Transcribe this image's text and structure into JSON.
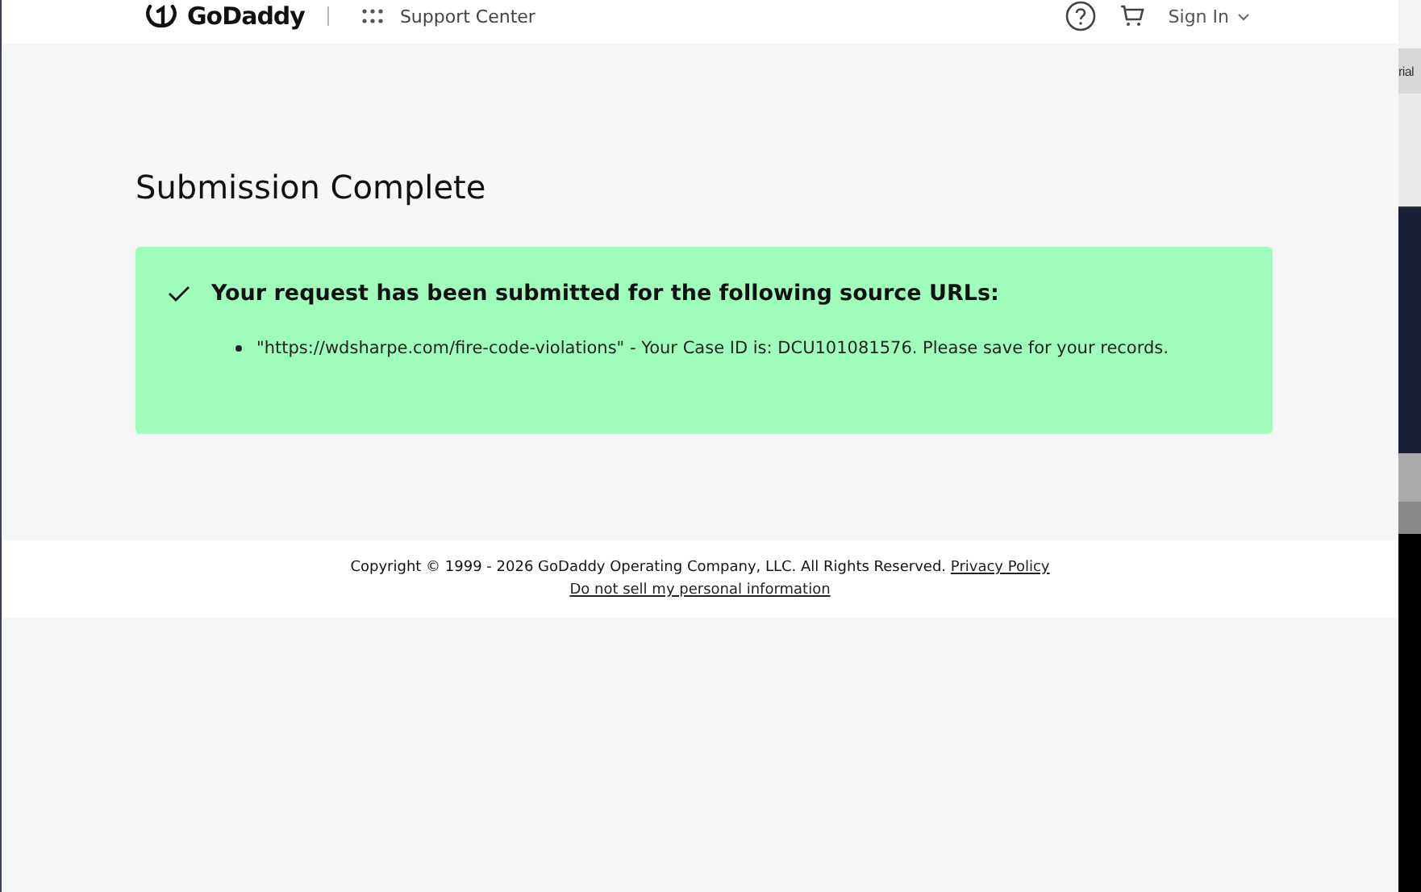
{
  "header": {
    "logo": "GoDaddy",
    "section": "Support Center",
    "sign_in": "Sign In"
  },
  "title": "Submission Complete",
  "alert": {
    "heading": "Your request has been submitted for the following source URLs:",
    "items": [
      "\"https://wdsharpe.com/fire-code-violations\" - Your Case ID is: DCU101081576. Please save for your records."
    ]
  },
  "footer": {
    "copyright": "Copyright © 1999 - 2026 GoDaddy Operating Company, LLC. All Rights Reserved.",
    "privacy_link": "Privacy Policy",
    "do_not_sell_link": "Do not sell my personal information"
  },
  "background_window": {
    "text": "rial"
  }
}
